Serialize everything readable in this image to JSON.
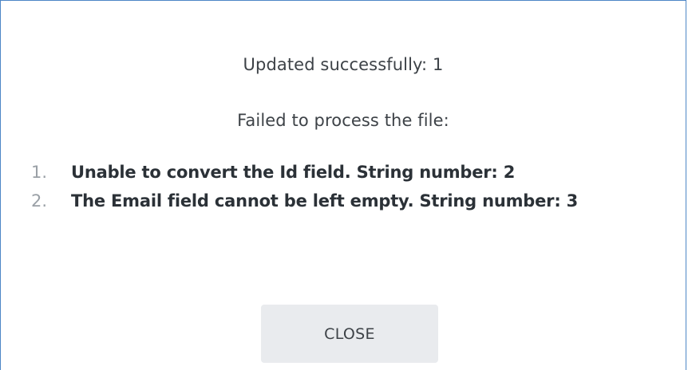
{
  "dialog": {
    "updated_text": "Updated successfully: 1",
    "failed_text": "Failed to process the file:",
    "errors": [
      {
        "number": "1.",
        "text": "Unable to convert the Id field. String number: 2"
      },
      {
        "number": "2.",
        "text": "The Email field cannot be left empty. String number: 3"
      }
    ],
    "close_label": "CLOSE"
  }
}
